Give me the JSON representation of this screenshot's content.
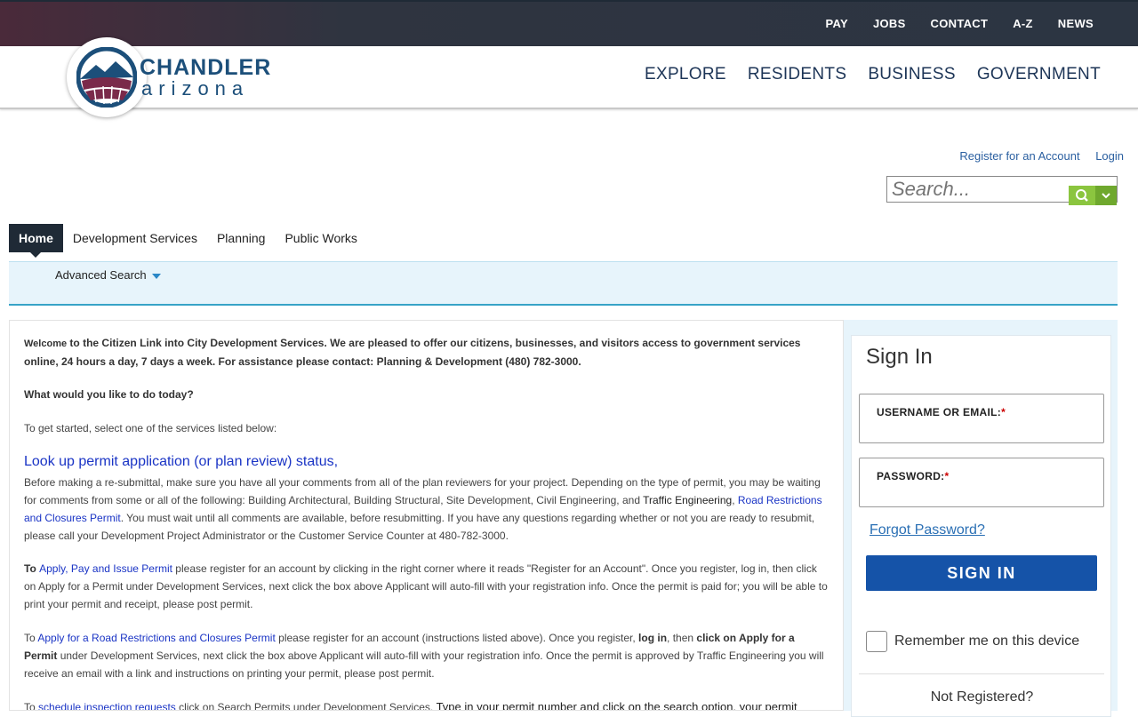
{
  "topbar": {
    "links": [
      "PAY",
      "JOBS",
      "CONTACT",
      "A-Z",
      "NEWS"
    ]
  },
  "logo": {
    "word1": "CHANDLER",
    "word2": "arizona"
  },
  "mainnav": [
    "EXPLORE",
    "RESIDENTS",
    "BUSINESS",
    "GOVERNMENT"
  ],
  "account": {
    "register": "Register for an Account",
    "login": "Login"
  },
  "search": {
    "placeholder": "Search..."
  },
  "tabs": [
    "Home",
    "Development Services",
    "Planning",
    "Public Works"
  ],
  "advanced_search": "Advanced Search",
  "content": {
    "welcome_word": "Welcome",
    "welcome_rest": " to the Citizen Link into City Development Services. We are pleased to offer our citizens, businesses, and visitors access to government services online, 24 hours a day, 7 days a week.  For assistance please contact:  Planning & Development (480) 782-3000.",
    "question": "What would you like to do today?",
    "get_started": "To get started, select one of the services listed below:",
    "lookup_title": "Look up permit application (or plan review) status,",
    "lookup_text1": "Before making a re-submittal, make sure you have all your comments from all of the plan reviewers for your project.  Depending on the type of permit, you may be waiting for comments from some or all of the following:  Building Architectural, Building Structural, Site Development, Civil Engineering, and ",
    "lookup_traffic": "Traffic Engineering",
    "lookup_comma": ", ",
    "lookup_road": "Road Restrictions and Closures Permit",
    "lookup_text2": ".  You must wait until all comments are available, before resubmitting.  If you have any questions regarding whether or not you are ready to resubmit, please call your Development Project Administrator or the Customer Service Counter at 480-782-3000.",
    "apply_to": "To ",
    "apply_link": "Apply, Pay and Issue Permit",
    "apply_text": " please register for an account by clicking in the right corner where it reads \"Register for an Account\". Once you register, log in, then click on Apply for a Permit under Development Services, next click the box above Applicant will auto-fill with your registration info. Once the permit is paid for; you will be able to print your permit and receipt, please post permit.",
    "road_to": "To ",
    "road_link": "Apply for a Road Restrictions and Closures Permit",
    "road_text1": " please register for an account (instructions listed above).  Once you register, ",
    "road_login": "log in",
    "road_then": ", then ",
    "road_click": "click on Apply for a Permit",
    "road_text2": " under Development Services, next click the box above Applicant will auto-fill with your registration info. Once the permit is approved by Traffic Engineering you will receive an email with a link and instructions on printing your permit, please post permit.",
    "insp_to": "To ",
    "insp_link": "schedule inspection requests",
    "insp_text1": " click on Search Permits under Development Services. ",
    "insp_text2": "Type in your permit number and click on the search option, your permit number will be listed under the Gen description. Click on the permit number for a list of inspections and click on the ones scheduled, listed at the far right."
  },
  "signin": {
    "title": "Sign In",
    "username_label": "USERNAME OR EMAIL:",
    "password_label": "PASSWORD:",
    "required_mark": "*",
    "forgot": "Forgot Password?",
    "button": "SIGN IN",
    "remember": "Remember me on this device",
    "not_registered": "Not Registered?"
  },
  "colors": {
    "nav": "#1d3557",
    "accent_green": "#8bc53f",
    "signin_button": "#1553a8",
    "link": "#1a34c5"
  }
}
